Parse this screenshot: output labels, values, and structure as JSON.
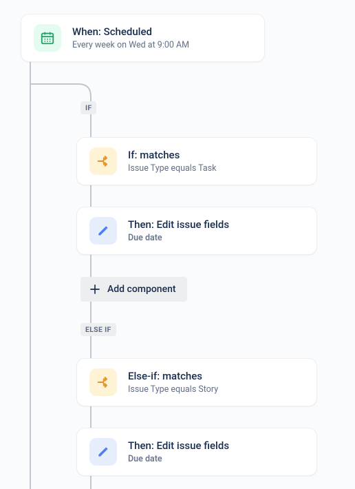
{
  "trigger": {
    "title": "When: Scheduled",
    "subtitle": "Every week on Wed at 9:00 AM"
  },
  "badges": {
    "if": "IF",
    "elseif": "ELSE IF"
  },
  "if_block": {
    "condition": {
      "title": "If: matches",
      "subtitle": "Issue Type equals Task"
    },
    "action": {
      "title": "Then: Edit issue fields",
      "subtitle": "Due date"
    }
  },
  "elseif_block": {
    "condition": {
      "title": "Else-if: matches",
      "subtitle": "Issue Type equals Story"
    },
    "action": {
      "title": "Then: Edit issue fields",
      "subtitle": "Due date"
    }
  },
  "add_component": {
    "label": "Add component"
  },
  "icons": {
    "calendar": "calendar-icon",
    "branch": "branch-icon",
    "edit": "edit-icon",
    "plus": "plus-icon"
  },
  "colors": {
    "green": "#22a06b",
    "orange": "#e2952e",
    "blue": "#4c7ef3",
    "badge_bg": "#eceef0"
  }
}
